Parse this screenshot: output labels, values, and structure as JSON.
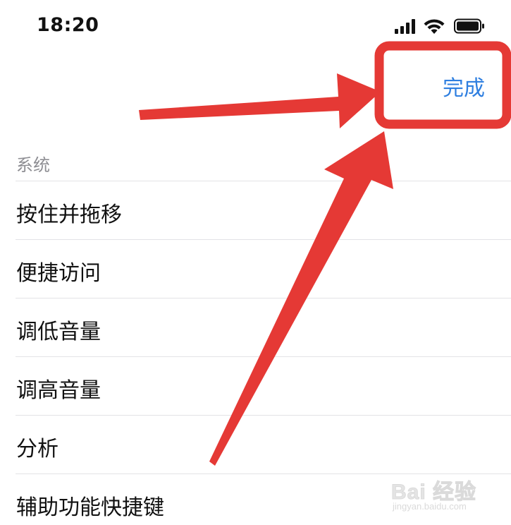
{
  "status_bar": {
    "time": "18:20"
  },
  "nav": {
    "done_label": "完成"
  },
  "section": {
    "header": "系统",
    "items": [
      {
        "label": "按住并拖移"
      },
      {
        "label": "便捷访问"
      },
      {
        "label": "调低音量"
      },
      {
        "label": "调高音量"
      },
      {
        "label": "分析"
      },
      {
        "label": "辅助功能快捷键"
      }
    ]
  },
  "watermark": {
    "logo": "Bai 经验",
    "url": "jingyan.baidu.com"
  },
  "colors": {
    "accent": "#2f7fe0",
    "annotation": "#e53935",
    "separator": "#e3e3e6",
    "section_header": "#8e8e93"
  },
  "icons": [
    "cellular-signal-icon",
    "wifi-icon",
    "battery-icon"
  ]
}
